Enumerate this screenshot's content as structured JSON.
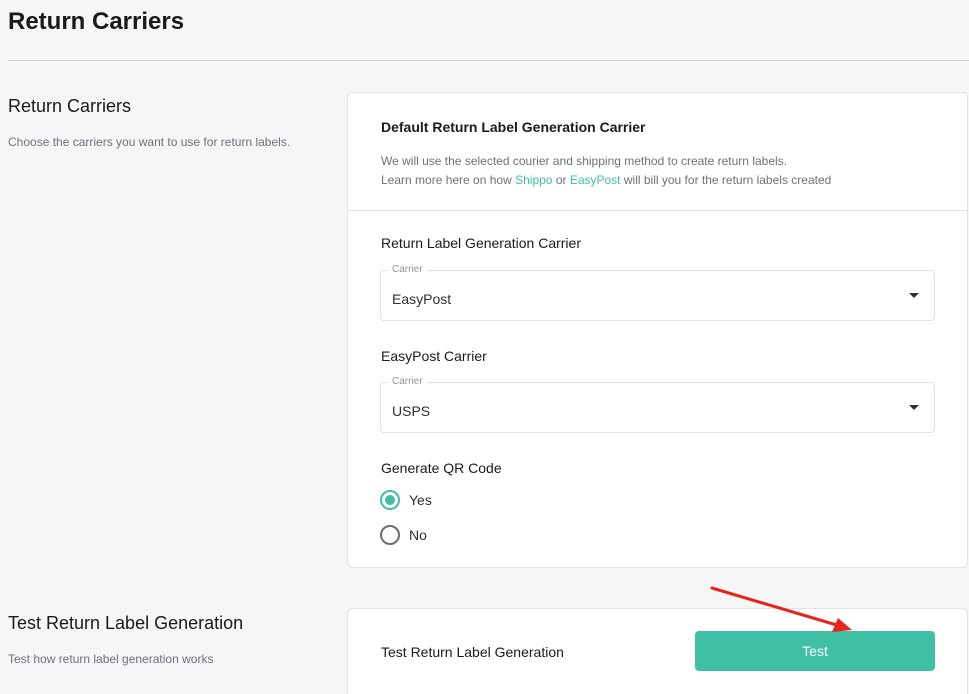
{
  "page": {
    "title": "Return Carriers"
  },
  "section1": {
    "title": "Return Carriers",
    "description": "Choose the carriers you want to use for return labels."
  },
  "card1": {
    "header_title": "Default Return Label Generation Carrier",
    "line1": "We will use the selected courier and shipping method to create return labels.",
    "line2_before": "Learn more here on how",
    "link_shippo": "Shippo",
    "line2_or": "or",
    "link_easypost": "EasyPost",
    "line2_after": "will bill you for the return labels created",
    "carrier_field": {
      "label": "Return Label Generation Carrier",
      "legend": "Carrier",
      "value": "EasyPost"
    },
    "easypost_field": {
      "label": "EasyPost Carrier",
      "legend": "Carrier",
      "value": "USPS"
    },
    "qr": {
      "label": "Generate QR Code",
      "options": [
        {
          "label": "Yes",
          "selected": true
        },
        {
          "label": "No",
          "selected": false
        }
      ]
    }
  },
  "section2": {
    "title": "Test Return Label Generation",
    "description": "Test how return label generation works"
  },
  "card2": {
    "label": "Test Return Label Generation",
    "button_label": "Test"
  },
  "colors": {
    "accent": "#3fbfa3",
    "annotation_arrow": "#e8231c"
  },
  "icons": {
    "dropdown": "chevron-down-icon",
    "annotation": "red-arrow-icon"
  }
}
